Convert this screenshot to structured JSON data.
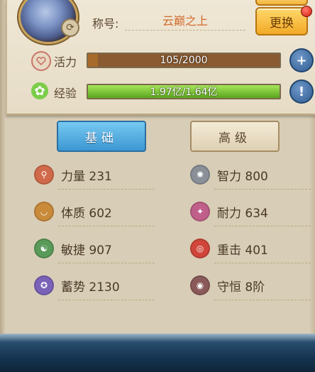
{
  "profile": {
    "title_label": "称号:",
    "title_value": "云巅之上",
    "change_button": "更换"
  },
  "stats": {
    "vitality": {
      "label": "活力",
      "current": 105,
      "max": 2000,
      "text": "105/2000",
      "fill_color": "#a86a2a"
    },
    "exp": {
      "label": "经验",
      "text": "1.97亿/1.64亿",
      "fill_fraction": 1.0,
      "fill_color": "#7ccd2a"
    }
  },
  "tabs": [
    {
      "label": "基础",
      "active": true
    },
    {
      "label": "高级",
      "active": false
    }
  ],
  "attributes": [
    {
      "name": "力量",
      "value": "231",
      "icon": "strength-icon",
      "color": "#d16a4a"
    },
    {
      "name": "智力",
      "value": "800",
      "icon": "intellect-icon",
      "color": "#8a8f98"
    },
    {
      "name": "体质",
      "value": "602",
      "icon": "constitution-icon",
      "color": "#c98a3a"
    },
    {
      "name": "耐力",
      "value": "634",
      "icon": "endurance-icon",
      "color": "#c0608a"
    },
    {
      "name": "敏捷",
      "value": "907",
      "icon": "agility-icon",
      "color": "#5a9a5a"
    },
    {
      "name": "重击",
      "value": "401",
      "icon": "heavy-strike-icon",
      "color": "#d0463a"
    },
    {
      "name": "蓄势",
      "value": "2130",
      "icon": "momentum-icon",
      "color": "#7a62b8"
    },
    {
      "name": "守恒",
      "value": "8阶",
      "icon": "conservation-icon",
      "color": "#8a5a5a"
    }
  ]
}
